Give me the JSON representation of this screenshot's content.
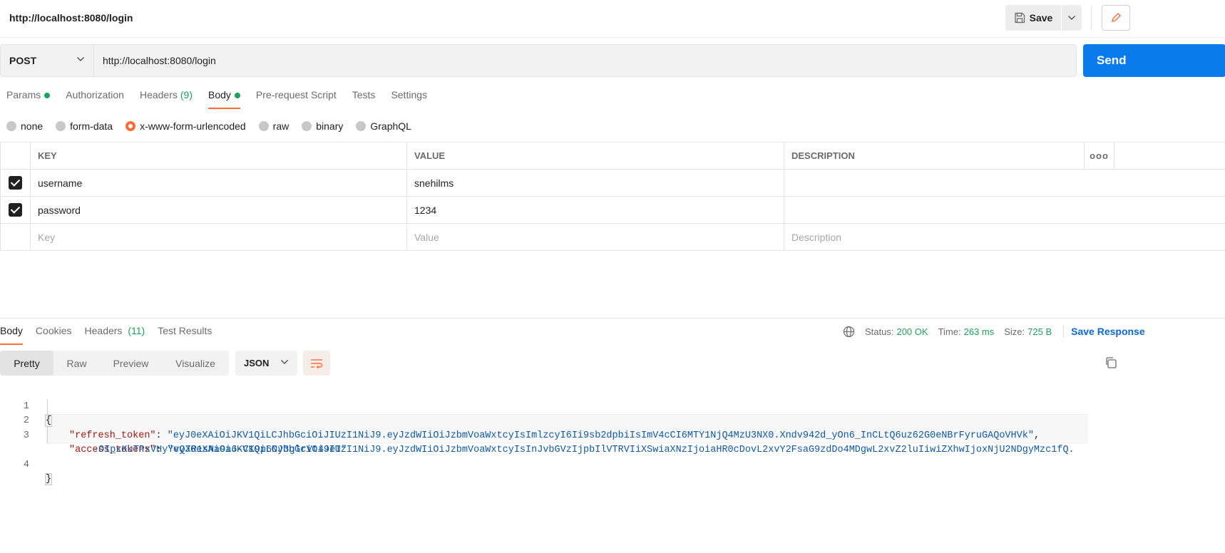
{
  "header": {
    "title": "http://localhost:8080/login",
    "save_label": "Save"
  },
  "request": {
    "method": "POST",
    "url": "http://localhost:8080/login",
    "send_label": "Send"
  },
  "request_tabs": [
    {
      "label": "Params",
      "dot": true
    },
    {
      "label": "Authorization"
    },
    {
      "label": "Headers",
      "count": "(9)"
    },
    {
      "label": "Body",
      "dot": true,
      "active": true
    },
    {
      "label": "Pre-request Script"
    },
    {
      "label": "Tests"
    },
    {
      "label": "Settings"
    }
  ],
  "body_types": [
    {
      "label": "none"
    },
    {
      "label": "form-data"
    },
    {
      "label": "x-www-form-urlencoded",
      "checked": true
    },
    {
      "label": "raw"
    },
    {
      "label": "binary"
    },
    {
      "label": "GraphQL"
    }
  ],
  "params_table": {
    "headers": {
      "key": "KEY",
      "value": "VALUE",
      "description": "DESCRIPTION",
      "more": "ooo"
    },
    "rows": [
      {
        "key": "username",
        "value": "snehilms",
        "description": ""
      },
      {
        "key": "password",
        "value": "1234",
        "description": ""
      }
    ],
    "placeholders": {
      "key": "Key",
      "value": "Value",
      "description": "Description"
    }
  },
  "response_tabs": [
    {
      "label": "Body",
      "active": true
    },
    {
      "label": "Cookies"
    },
    {
      "label": "Headers",
      "count": "(11)"
    },
    {
      "label": "Test Results"
    }
  ],
  "response_meta": {
    "status_label": "Status:",
    "status_value": "200 OK",
    "time_label": "Time:",
    "time_value": "263 ms",
    "size_label": "Size:",
    "size_value": "725 B",
    "save_response_label": "Save Response"
  },
  "view_modes": [
    "Pretty",
    "Raw",
    "Preview",
    "Visualize"
  ],
  "format": "JSON",
  "code": {
    "line_numbers": [
      "1",
      "2",
      "3",
      "4"
    ],
    "open_brace": "{",
    "close_brace": "}",
    "refresh_key": "\"refresh_token\"",
    "refresh_value": "\"eyJ0eXAiOiJKV1QiLCJhbGciOiJIUzI1NiJ9.eyJzdWIiOiJzbmVoaWxtcyIsImlzcyI6Ii9sb2dpbiIsImV4cCI6MTY1NjQ4MzU3NX0.Xndv942d_yOn6_InCLtQ6uz62G0eNBrFyruGAQoVHVk\"",
    "access_key": "\"access_tokens\"",
    "access_value_1": "\"eyJ0eXAiOiJKV1QiLCJhbGciOiJIUzI1NiJ9.eyJzdWIiOiJzbmVoaWxtcyIsInJvbGVzIjpbIlVTRVIiXSwiaXNzIjoiaHR0cDovL2xvY2FsaG9zdDo4MDgwL2xvZ2luIiwiZXhwIjoxNjU2NDgyMzc1fQ.",
    "access_value_2": "-OIpxKuTPxVHyYvQXR1sNa9a6-CK9p6Ny3glrVt49eI\""
  },
  "colors": {
    "accent": "#ff6c37",
    "send": "#097bed",
    "success": "#1ca25b",
    "json_key": "#a3170e",
    "json_string": "#0f5aa6"
  }
}
